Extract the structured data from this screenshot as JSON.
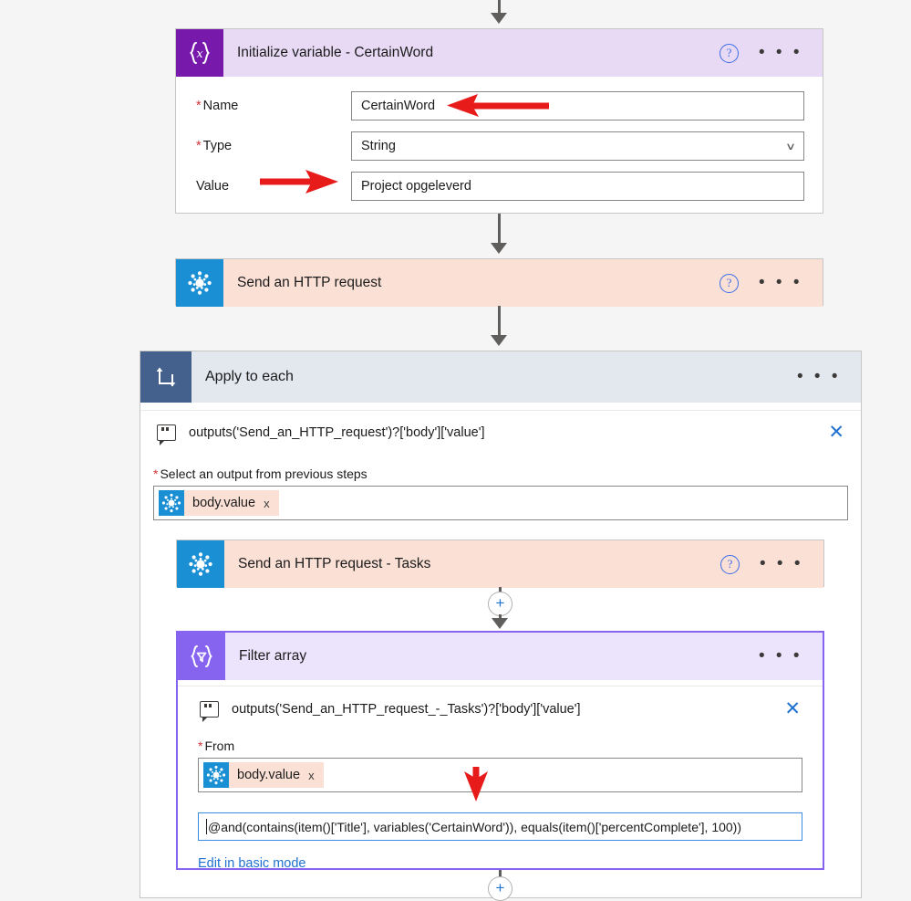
{
  "colors": {
    "page_bg": "#f5f5f5",
    "variable_purple": "#7719aa",
    "variable_header": "#e8daf5",
    "sharepoint_blue": "#1a8fd4",
    "http_header": "#fbe0d6",
    "loop_tile": "#43618c",
    "loop_header": "#e3e8ef",
    "filter_purple": "#8764f0",
    "filter_header": "#ece4fd",
    "accent_link": "#1f72d0",
    "annotation_red": "#e81b1b",
    "required_red": "#d13438"
  },
  "steps": {
    "initialize_variable": {
      "icon": "variable-braces-x-icon",
      "title": "Initialize variable - CertainWord",
      "help_label": "?",
      "menu_label": "• • •",
      "fields": [
        {
          "label": "Name",
          "required": true,
          "value": "CertainWord",
          "type": "text"
        },
        {
          "label": "Type",
          "required": true,
          "value": "String",
          "type": "select",
          "chevron": "∨"
        },
        {
          "label": "Value",
          "required": false,
          "value": "Project opgeleverd",
          "type": "text"
        }
      ]
    },
    "send_http_request": {
      "icon": "sharepoint-icon",
      "title": "Send an HTTP request",
      "help_label": "?",
      "menu_label": "• • •"
    },
    "apply_to_each": {
      "icon": "loop-repeat-icon",
      "title": "Apply to each",
      "menu_label": "• • •",
      "expression": "outputs('Send_an_HTTP_request')?['body']['value']",
      "close_label": "✕",
      "output_selector": {
        "label": "Select an output from previous steps",
        "required": true,
        "token": {
          "icon": "sharepoint-icon",
          "label": "body.value",
          "remove_label": "x"
        }
      }
    },
    "send_http_request_tasks": {
      "icon": "sharepoint-icon",
      "title": "Send an HTTP request - Tasks",
      "help_label": "?",
      "menu_label": "• • •"
    },
    "filter_array": {
      "icon": "filter-braces-icon",
      "title": "Filter array",
      "menu_label": "• • •",
      "expression": "outputs('Send_an_HTTP_request_-_Tasks')?['body']['value']",
      "close_label": "✕",
      "from_field": {
        "label": "From",
        "required": true,
        "token": {
          "icon": "sharepoint-icon",
          "label": "body.value",
          "remove_label": "x"
        }
      },
      "condition_expression": "@and(contains(item()['Title'], variables('CertainWord')), equals(item()['percentComplete'], 100))",
      "mode_link": "Edit in basic mode"
    }
  },
  "connectors": {
    "add_step_label": "+"
  },
  "annotations": [
    {
      "name": "arrow-to-name-field",
      "direction": "left"
    },
    {
      "name": "arrow-to-value-field",
      "direction": "right"
    },
    {
      "name": "arrow-to-condition-expression",
      "direction": "down"
    }
  ]
}
